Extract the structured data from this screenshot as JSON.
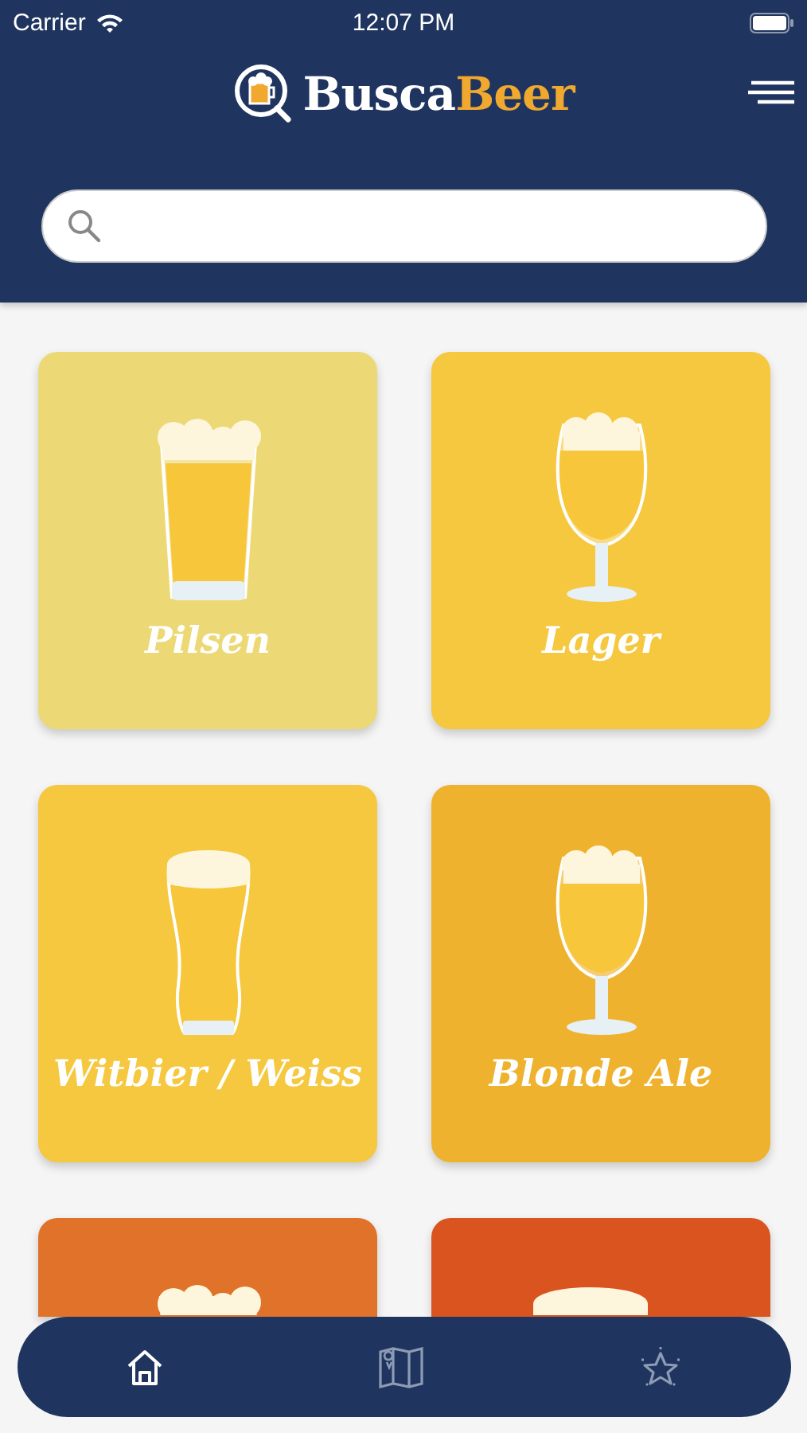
{
  "status_bar": {
    "carrier": "Carrier",
    "time": "12:07 PM"
  },
  "logo": {
    "words": [
      {
        "text": "Busca",
        "color": "#ffffff"
      },
      {
        "text": "Beer",
        "color": "#f0a92e"
      }
    ]
  },
  "categories": [
    {
      "name": "Pilsen",
      "color": "#ecd976",
      "kind": "pint"
    },
    {
      "name": "Lager",
      "color": "#f5c840",
      "kind": "tulip"
    },
    {
      "name": "Witbier / Weiss",
      "color": "#f5c840",
      "kind": "weizen"
    },
    {
      "name": "Blonde Ale",
      "color": "#eeb22e",
      "kind": "tulip"
    },
    {
      "color": "#e07229",
      "kind": "pint"
    },
    {
      "color": "#d9541f",
      "kind": "mug"
    }
  ],
  "tab_bar": [
    {
      "kind": "home",
      "selected": true
    },
    {
      "kind": "map",
      "selected": false
    },
    {
      "kind": "star",
      "selected": false
    }
  ]
}
